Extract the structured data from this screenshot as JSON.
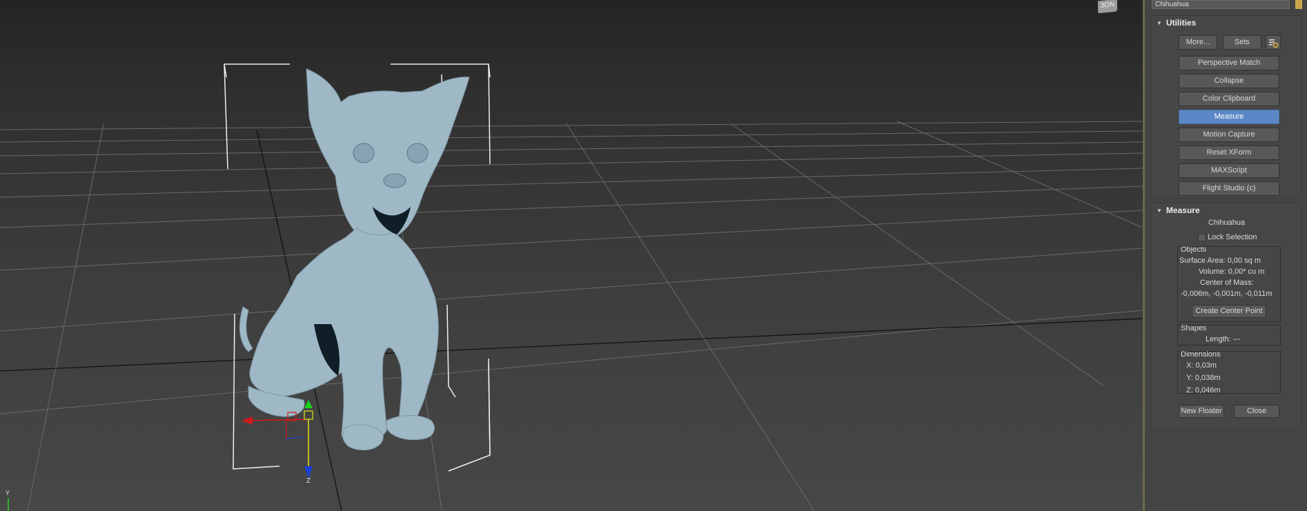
{
  "viewport": {
    "viewcube_label": "3ON",
    "axis_labels": {
      "y": "Y",
      "z": "Z"
    }
  },
  "panel": {
    "object_name": "Chihuahua",
    "utilities": {
      "title": "Utilities",
      "more_label": "More...",
      "sets_label": "Sets",
      "buttons": [
        "Perspective Match",
        "Collapse",
        "Color Clipboard",
        "Measure",
        "Motion Capture",
        "Reset XForm",
        "MAXScript",
        "Flight Studio (c)"
      ],
      "active_button": "Measure"
    },
    "measure": {
      "title": "Measure",
      "object": "Chihuahua",
      "lock_selection": "Lock Selection",
      "objects_title": "Objects",
      "surface_area": "Surface Area:  0,00 sq m",
      "volume": "Volume:  0,00* cu m",
      "center_of_mass_label": "Center of Mass:",
      "center_of_mass_value": "-0,006m, -0,001m, -0,011m",
      "create_center_point": "Create Center Point",
      "shapes_title": "Shapes",
      "length": "Length:  ---",
      "dimensions_title": "Dimensions",
      "dim_x": "X:   0,03m",
      "dim_y": "Y:   0,038m",
      "dim_z": "Z:   0,046m",
      "new_floater": "New Floater",
      "close": "Close"
    }
  },
  "colors": {
    "active_button": "#5b87c6",
    "dog_surface": "#9fb8c6",
    "panel_bg": "#444444"
  }
}
